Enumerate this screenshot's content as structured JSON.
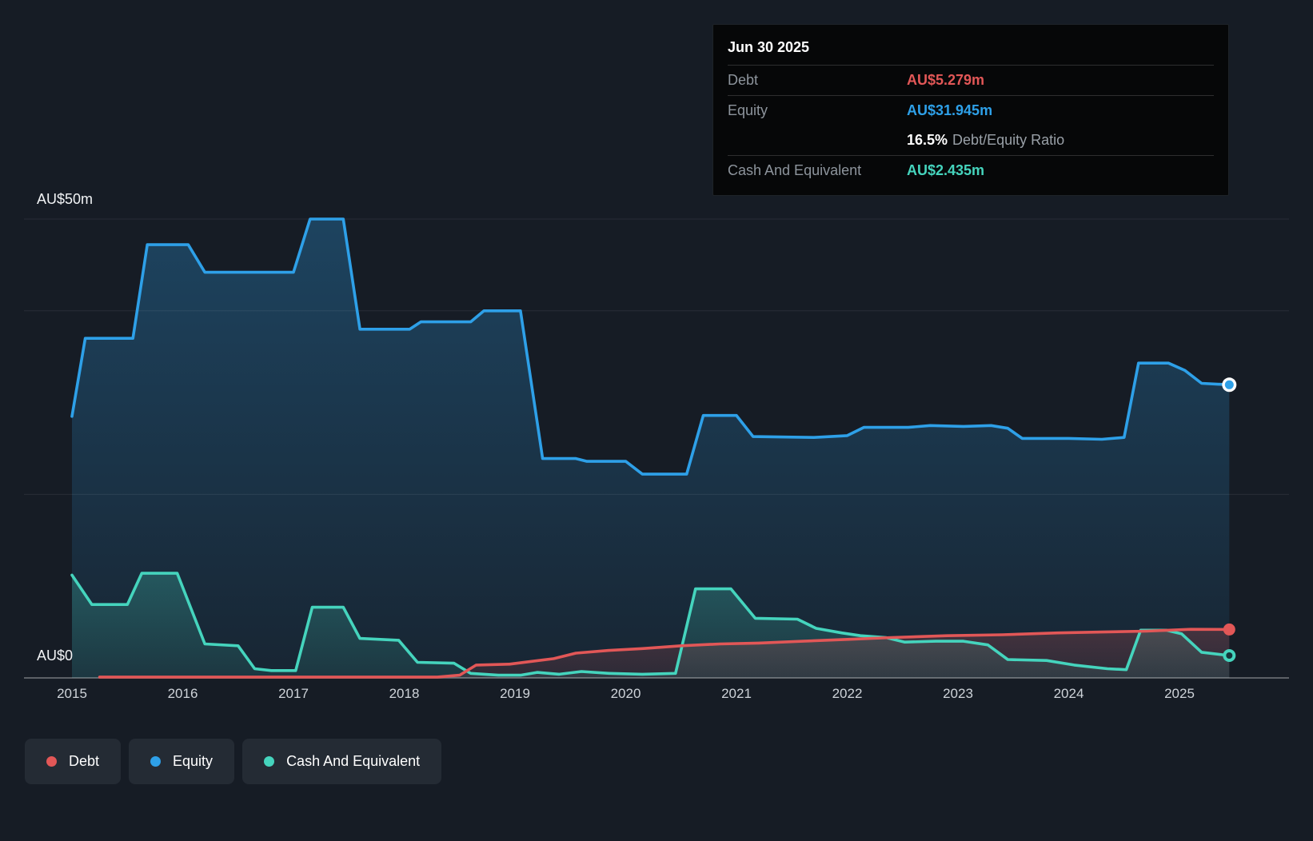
{
  "colors": {
    "debt": "#e25757",
    "equity": "#2ea0e8",
    "cash": "#45d4bd"
  },
  "axis": {
    "y_max_label": "AU$50m",
    "y_zero_label": "AU$0",
    "x_ticks": [
      "2015",
      "2016",
      "2017",
      "2018",
      "2019",
      "2020",
      "2021",
      "2022",
      "2023",
      "2024",
      "2025"
    ]
  },
  "tooltip": {
    "date": "Jun 30 2025",
    "debt_label": "Debt",
    "debt_value": "AU$5.279m",
    "equity_label": "Equity",
    "equity_value": "AU$31.945m",
    "ratio_value": "16.5%",
    "ratio_label": "Debt/Equity Ratio",
    "cash_label": "Cash And Equivalent",
    "cash_value": "AU$2.435m"
  },
  "legend": {
    "debt": "Debt",
    "equity": "Equity",
    "cash": "Cash And Equivalent"
  },
  "chart_data": {
    "type": "area",
    "x_unit": "year",
    "x_range": [
      2015,
      2025.5
    ],
    "ylabel": "AU$m",
    "y_range": [
      0,
      50
    ],
    "gridline_values": [
      0,
      20,
      40,
      50
    ],
    "legend_position": "bottom-left",
    "series": [
      {
        "name": "Equity",
        "color": "#2ea0e8",
        "end_value": 31.945,
        "points": [
          [
            2015.0,
            28.5
          ],
          [
            2015.12,
            37.0
          ],
          [
            2015.55,
            37.0
          ],
          [
            2015.68,
            47.2
          ],
          [
            2016.05,
            47.2
          ],
          [
            2016.2,
            44.2
          ],
          [
            2017.0,
            44.2
          ],
          [
            2017.15,
            50.0
          ],
          [
            2017.45,
            50.0
          ],
          [
            2017.6,
            38.0
          ],
          [
            2018.05,
            38.0
          ],
          [
            2018.15,
            38.8
          ],
          [
            2018.6,
            38.8
          ],
          [
            2018.72,
            40.0
          ],
          [
            2019.05,
            40.0
          ],
          [
            2019.25,
            23.9
          ],
          [
            2019.55,
            23.9
          ],
          [
            2019.65,
            23.6
          ],
          [
            2020.0,
            23.6
          ],
          [
            2020.15,
            22.2
          ],
          [
            2020.55,
            22.2
          ],
          [
            2020.7,
            28.6
          ],
          [
            2021.0,
            28.6
          ],
          [
            2021.15,
            26.3
          ],
          [
            2021.7,
            26.2
          ],
          [
            2022.0,
            26.4
          ],
          [
            2022.15,
            27.3
          ],
          [
            2022.55,
            27.3
          ],
          [
            2022.75,
            27.5
          ],
          [
            2023.05,
            27.4
          ],
          [
            2023.3,
            27.5
          ],
          [
            2023.45,
            27.2
          ],
          [
            2023.58,
            26.1
          ],
          [
            2024.0,
            26.1
          ],
          [
            2024.3,
            26.0
          ],
          [
            2024.5,
            26.2
          ],
          [
            2024.63,
            34.3
          ],
          [
            2024.9,
            34.3
          ],
          [
            2025.05,
            33.5
          ],
          [
            2025.2,
            32.1
          ],
          [
            2025.45,
            31.945
          ]
        ]
      },
      {
        "name": "Cash And Equivalent",
        "color": "#45d4bd",
        "end_value": 2.435,
        "points": [
          [
            2015.0,
            11.2
          ],
          [
            2015.18,
            8.0
          ],
          [
            2015.5,
            8.0
          ],
          [
            2015.63,
            11.4
          ],
          [
            2015.95,
            11.4
          ],
          [
            2016.2,
            3.7
          ],
          [
            2016.5,
            3.5
          ],
          [
            2016.65,
            1.0
          ],
          [
            2016.8,
            0.8
          ],
          [
            2017.02,
            0.8
          ],
          [
            2017.17,
            7.7
          ],
          [
            2017.45,
            7.7
          ],
          [
            2017.6,
            4.3
          ],
          [
            2017.95,
            4.1
          ],
          [
            2018.12,
            1.7
          ],
          [
            2018.45,
            1.6
          ],
          [
            2018.6,
            0.5
          ],
          [
            2018.85,
            0.3
          ],
          [
            2019.05,
            0.3
          ],
          [
            2019.2,
            0.6
          ],
          [
            2019.4,
            0.4
          ],
          [
            2019.6,
            0.7
          ],
          [
            2019.85,
            0.5
          ],
          [
            2020.15,
            0.4
          ],
          [
            2020.45,
            0.5
          ],
          [
            2020.63,
            9.7
          ],
          [
            2020.95,
            9.7
          ],
          [
            2021.17,
            6.5
          ],
          [
            2021.55,
            6.4
          ],
          [
            2021.72,
            5.4
          ],
          [
            2021.95,
            4.9
          ],
          [
            2022.12,
            4.6
          ],
          [
            2022.35,
            4.4
          ],
          [
            2022.52,
            3.9
          ],
          [
            2022.8,
            4.0
          ],
          [
            2023.05,
            4.0
          ],
          [
            2023.27,
            3.6
          ],
          [
            2023.45,
            2.0
          ],
          [
            2023.8,
            1.9
          ],
          [
            2024.05,
            1.4
          ],
          [
            2024.35,
            1.0
          ],
          [
            2024.52,
            0.9
          ],
          [
            2024.65,
            5.2
          ],
          [
            2024.88,
            5.2
          ],
          [
            2025.02,
            4.8
          ],
          [
            2025.2,
            2.8
          ],
          [
            2025.45,
            2.435
          ]
        ]
      },
      {
        "name": "Debt",
        "color": "#e25757",
        "end_value": 5.279,
        "points": [
          [
            2015.25,
            0.1
          ],
          [
            2016.5,
            0.1
          ],
          [
            2017.5,
            0.1
          ],
          [
            2018.3,
            0.1
          ],
          [
            2018.5,
            0.3
          ],
          [
            2018.65,
            1.4
          ],
          [
            2018.95,
            1.5
          ],
          [
            2019.15,
            1.8
          ],
          [
            2019.35,
            2.1
          ],
          [
            2019.55,
            2.7
          ],
          [
            2019.85,
            3.0
          ],
          [
            2020.15,
            3.2
          ],
          [
            2020.5,
            3.5
          ],
          [
            2020.85,
            3.7
          ],
          [
            2021.2,
            3.8
          ],
          [
            2021.6,
            4.0
          ],
          [
            2022.0,
            4.2
          ],
          [
            2022.4,
            4.4
          ],
          [
            2022.9,
            4.6
          ],
          [
            2023.4,
            4.7
          ],
          [
            2023.9,
            4.9
          ],
          [
            2024.3,
            5.0
          ],
          [
            2024.7,
            5.1
          ],
          [
            2025.1,
            5.3
          ],
          [
            2025.45,
            5.279
          ]
        ]
      }
    ]
  }
}
